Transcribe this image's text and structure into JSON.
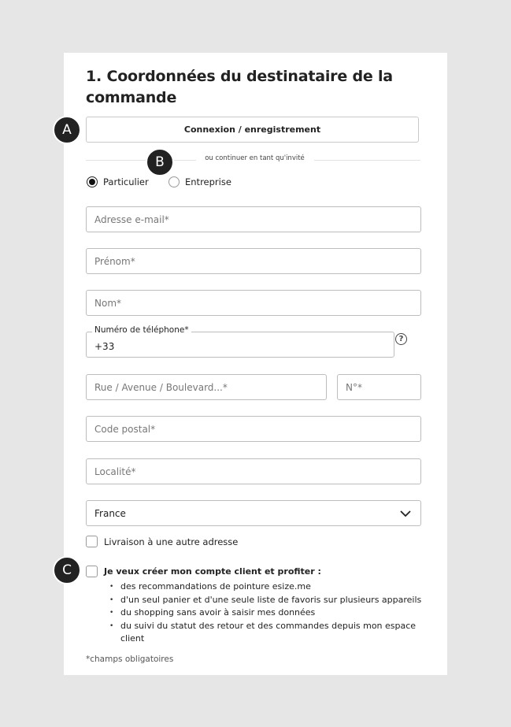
{
  "form": {
    "title": "1. Coordonnées du destinataire de la commande",
    "login_button": "Connexion / enregistrement",
    "divider_text": "ou continuer en tant qu'invité",
    "customer_type": {
      "options": [
        "Particulier",
        "Entreprise"
      ],
      "selected": "Particulier"
    },
    "fields": {
      "email_placeholder": "Adresse e-mail*",
      "firstname_placeholder": "Prénom*",
      "lastname_placeholder": "Nom*",
      "phone_label": "Numéro de téléphone*",
      "phone_value": "+33",
      "street_placeholder": "Rue / Avenue / Boulevard...*",
      "number_placeholder": "N°*",
      "postal_placeholder": "Code postal*",
      "city_placeholder": "Localité*",
      "country_value": "France"
    },
    "help_icon_glyph": "?",
    "other_address_label": "Livraison à une autre adresse",
    "create_account_label": "Je veux créer mon compte client et profiter :",
    "benefits": [
      "des recommandations de pointure esize.me",
      "d'un seul panier et d'une seule liste de favoris sur plusieurs appareils",
      "du shopping sans avoir à saisir mes données",
      "du suivi du statut des retour et des commandes depuis mon espace client"
    ],
    "footnote": "*champs obligatoires"
  },
  "markers": {
    "a": "A",
    "b": "B",
    "c": "C"
  },
  "colors": {
    "background": "#e6e6e6",
    "card": "#ffffff",
    "border": "#bdbdbd",
    "marker": "#222222"
  }
}
